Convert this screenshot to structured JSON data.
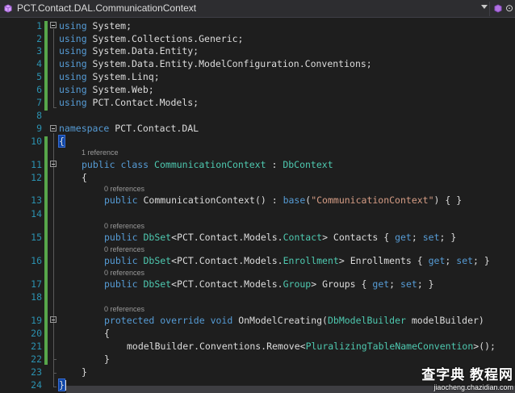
{
  "navbar": {
    "title": "PCT.Contact.DAL.CommunicationContext",
    "title_right": "⊙",
    "icon": "class-icon",
    "icon_right": "member-icon"
  },
  "line_numbers": [
    "1",
    "2",
    "3",
    "4",
    "5",
    "6",
    "7",
    "8",
    "9",
    "10",
    "11",
    "12",
    "13",
    "14",
    "15",
    "16",
    "17",
    "18",
    "19",
    "20",
    "21",
    "22",
    "23",
    "24"
  ],
  "codelens": {
    "class_refs": "1 reference",
    "ctor_refs": "0 references",
    "contacts_refs": "0 references",
    "enrollments_refs": "0 references",
    "groups_refs": "0 references",
    "onmodel_refs": "0 references"
  },
  "code": {
    "l1": {
      "kw": "using",
      "rest": " System;"
    },
    "l2": {
      "kw": "using",
      "rest": " System.Collections.Generic;"
    },
    "l3": {
      "kw": "using",
      "rest": " System.Data.Entity;"
    },
    "l4": {
      "kw": "using",
      "rest": " System.Data.Entity.ModelConfiguration.Conventions;"
    },
    "l5": {
      "kw": "using",
      "rest": " System.Linq;"
    },
    "l6": {
      "kw": "using",
      "rest": " System.Web;"
    },
    "l7": {
      "kw": "using",
      "rest": " PCT.Contact.Models;"
    },
    "l9": {
      "kw": "namespace",
      "rest": " PCT.Contact.DAL"
    },
    "l10": {
      "text": "{"
    },
    "l11": {
      "kw1": "public",
      "kw2": "class",
      "name": "CommunicationContext",
      "sep": " : ",
      "base": "DbContext"
    },
    "l12": {
      "text": "{"
    },
    "l13": {
      "kw1": "public",
      "name": " CommunicationContext() : ",
      "kw2": "base",
      "open": "(",
      "str": "\"CommunicationContext\"",
      "close": ") { }"
    },
    "l15": {
      "kw1": "public",
      "type": "DbSet",
      "pre": "<PCT.Contact.Models.",
      "model": "Contact",
      "post": "> Contacts { ",
      "get": "get",
      "mid": "; ",
      "set": "set",
      "end": "; }"
    },
    "l16": {
      "kw1": "public",
      "type": "DbSet",
      "pre": "<PCT.Contact.Models.",
      "model": "Enrollment",
      "post": "> Enrollments { ",
      "get": "get",
      "mid": "; ",
      "set": "set",
      "end": "; }"
    },
    "l17": {
      "kw1": "public",
      "type": "DbSet",
      "pre": "<PCT.Contact.Models.",
      "model": "Group",
      "post": "> Groups { ",
      "get": "get",
      "mid": "; ",
      "set": "set",
      "end": "; }"
    },
    "l19": {
      "kw1": "protected",
      "kw2": "override",
      "kw3": "void",
      "name": " OnModelCreating(",
      "type": "DbModelBuilder",
      "rest": " modelBuilder)"
    },
    "l20": {
      "text": "{"
    },
    "l21": {
      "pre": "modelBuilder.Conventions.Remove<",
      "type": "PluralizingTableNameConvention",
      "post": ">();"
    },
    "l22": {
      "text": "}"
    },
    "l23": {
      "text": "}"
    },
    "l24": {
      "text": "}"
    }
  },
  "watermark": {
    "main": "查字典 教程网",
    "sub": "jiaocheng.chazidian.com"
  }
}
